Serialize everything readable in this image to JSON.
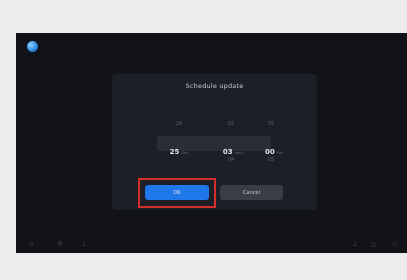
{
  "dialog": {
    "title": "Schedule update",
    "picker": {
      "day": {
        "prev": "24",
        "current": "25",
        "next": "",
        "unit": "Day"
      },
      "hour": {
        "prev": "02",
        "current": "03",
        "next": "04",
        "unit": "Hour"
      },
      "minute": {
        "prev": "55",
        "current": "00",
        "next": "05",
        "unit": "Min"
      }
    },
    "ok_label": "OK",
    "cancel_label": "Cancel"
  },
  "highlight_color": "#d62d2d",
  "accent_color": "#1e78ea",
  "icons": [
    "home-icon",
    "fan-icon",
    "seat-heat-icon",
    "seat-heat-right-icon",
    "defrost-icon",
    "volume-icon"
  ]
}
